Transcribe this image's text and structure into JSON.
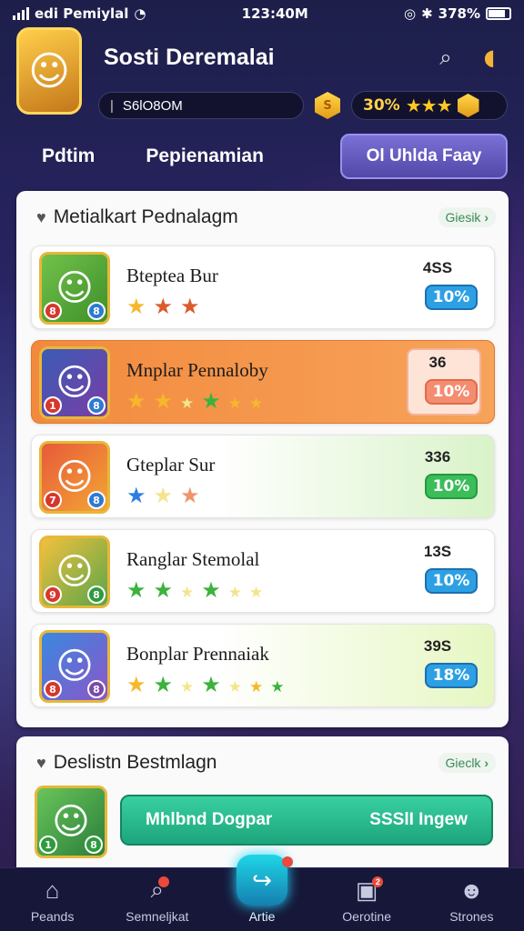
{
  "status_bar": {
    "carrier": "edi Pemiylal",
    "time": "123:40M",
    "battery": "378%"
  },
  "header": {
    "title": "Sosti Deremalai",
    "coins": "S6lO8OM",
    "hex_icon_text": "S",
    "rating_percent": "30%",
    "rating_stars": "★★★"
  },
  "tabs": {
    "items": [
      "Pdtim",
      "Pepienamian"
    ],
    "cta": "Ol Uhlda Faay"
  },
  "panel_main": {
    "title": "Metialkart Pednalagm",
    "more": "Giesik",
    "rows": [
      {
        "name": "Bteptea Bur",
        "score": "4SS",
        "percent": "10%"
      },
      {
        "name": "Mnplar Pennaloby",
        "score": "36",
        "percent": "10%"
      },
      {
        "name": "Gteplar Sur",
        "score": "336",
        "percent": "10%"
      },
      {
        "name": "Ranglar Stemolal",
        "score": "13S",
        "percent": "10%"
      },
      {
        "name": "Bonplar Prennaiak",
        "score": "39S",
        "percent": "18%"
      }
    ]
  },
  "panel_second": {
    "title": "Deslistn Bestmlagn",
    "more": "Gieclk",
    "cta_left": "Mhlbnd Dogpar",
    "cta_right": "SSSlI Ingew"
  },
  "bottom_nav": {
    "items": [
      "Peands",
      "Semneljkat",
      "Artie",
      "Oerotine",
      "Strones"
    ]
  },
  "colors": {
    "accent_purple": "#5148a8",
    "cta_green": "#1da57c",
    "highlight_orange": "#f28a3e",
    "badge_blue": "#2da0e4"
  }
}
